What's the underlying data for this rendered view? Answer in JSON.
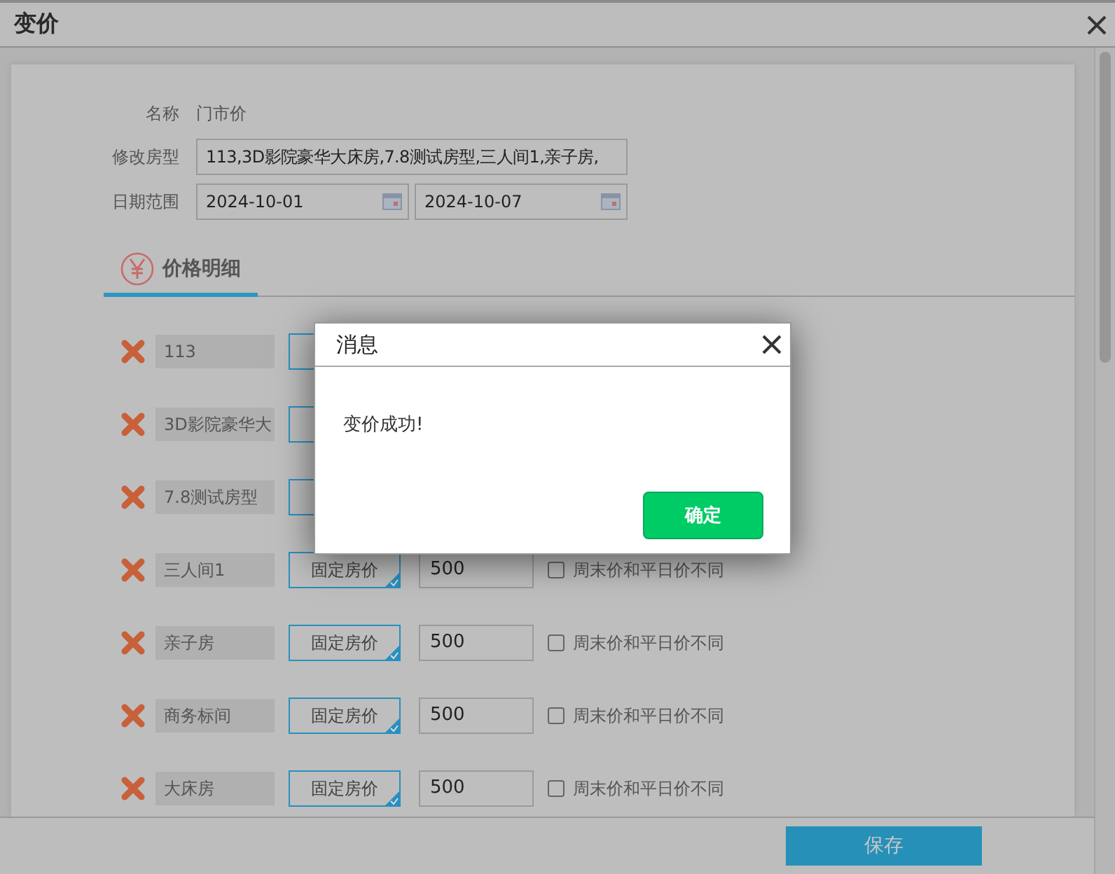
{
  "window": {
    "title": "变价"
  },
  "form": {
    "name_label": "名称",
    "name_value": "门市价",
    "room_type_label": "修改房型",
    "room_type_value": "113,3D影院豪华大床房,7.8测试房型,三人间1,亲子房,",
    "date_label": "日期范围",
    "date_start": "2024-10-01",
    "date_end": "2024-10-07"
  },
  "tabs": [
    {
      "label": "价格明细",
      "selected": true
    }
  ],
  "rooms": [
    {
      "name": "113"
    },
    {
      "name": "3D影院豪华大"
    },
    {
      "name": "7.8测试房型"
    },
    {
      "name": "三人间1",
      "type": "固定房价",
      "price": "500",
      "weekend_label": "周末价和平日价不同",
      "checked": false
    },
    {
      "name": "亲子房",
      "type": "固定房价",
      "price": "500",
      "weekend_label": "周末价和平日价不同",
      "checked": false
    },
    {
      "name": "商务标间",
      "type": "固定房价",
      "price": "500",
      "weekend_label": "周末价和平日价不同",
      "checked": false
    },
    {
      "name": "大床房",
      "type": "固定房价",
      "price": "500",
      "weekend_label": "周末价和平日价不同",
      "checked": false
    }
  ],
  "footer": {
    "save": "保存"
  },
  "dialog": {
    "title": "消息",
    "message": "变价成功!",
    "ok": "确定"
  }
}
